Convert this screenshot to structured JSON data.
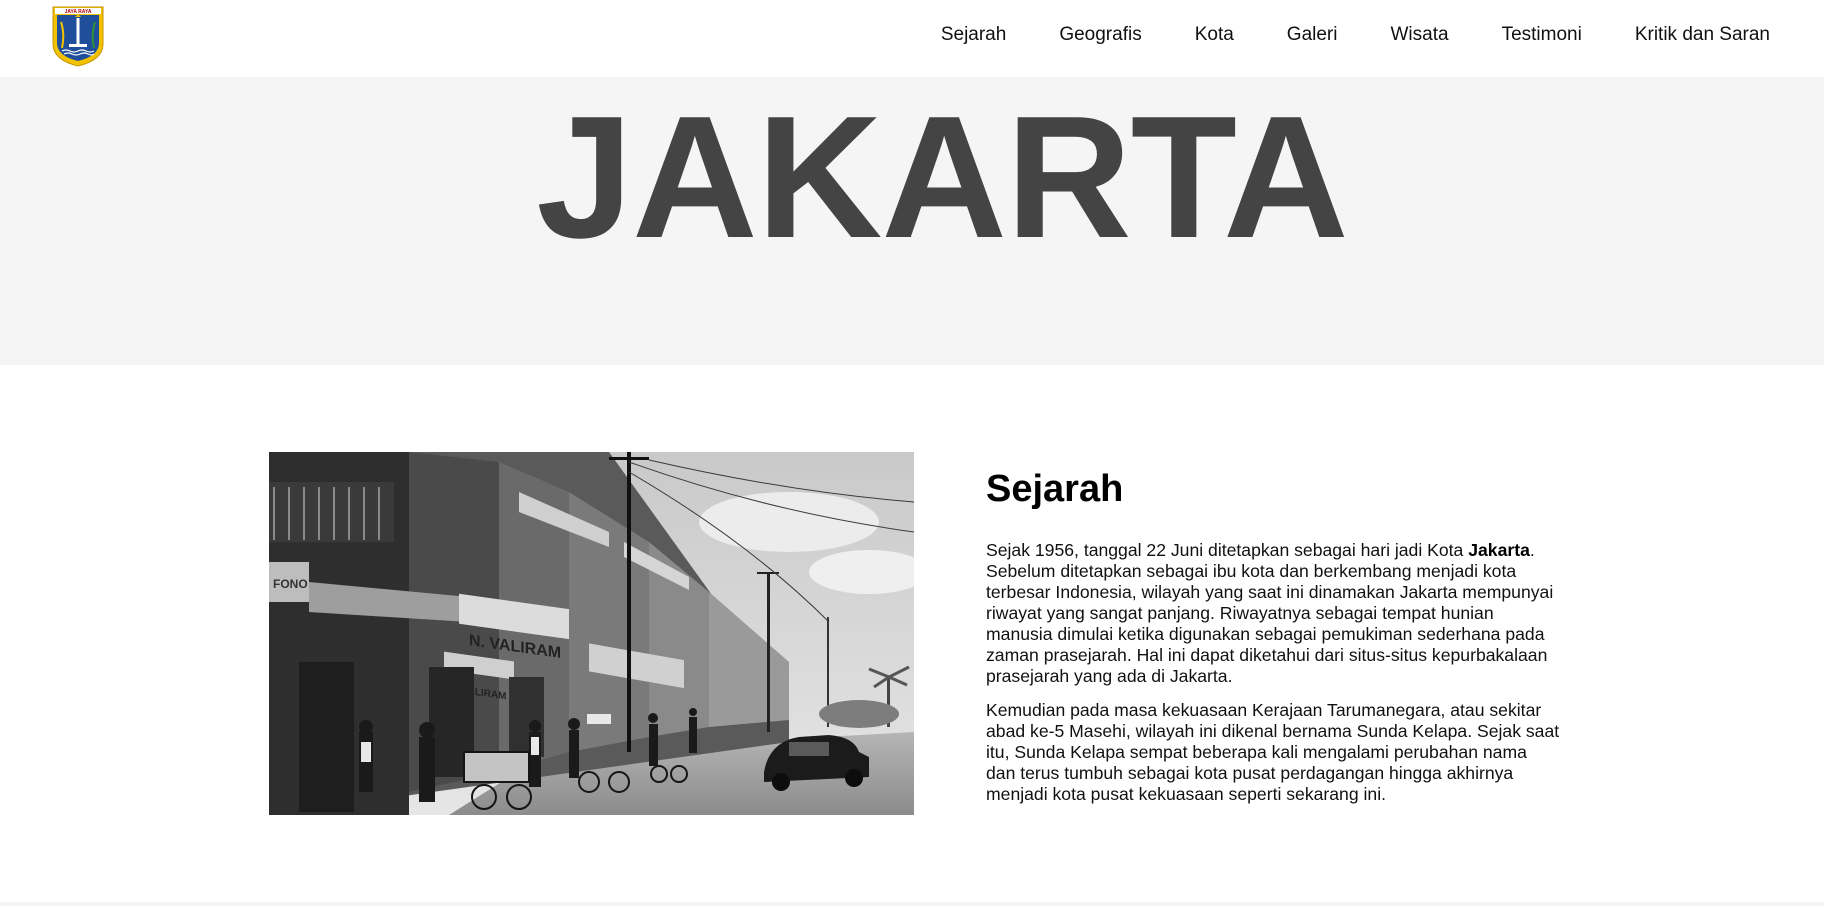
{
  "header": {
    "logo": {
      "icon": "jakarta-coat-of-arms-icon",
      "text": "JAYA RAYA"
    },
    "nav": [
      {
        "label": "Sejarah"
      },
      {
        "label": "Geografis"
      },
      {
        "label": "Kota"
      },
      {
        "label": "Galeri"
      },
      {
        "label": "Wisata"
      },
      {
        "label": "Testimoni"
      },
      {
        "label": "Kritik dan Saran"
      }
    ]
  },
  "hero": {
    "title": "JAKARTA"
  },
  "history": {
    "image_alt": "Foto hitam putih jalan pertokoan Jakarta tempo dulu",
    "shop_signs": [
      "N. VALIRAM",
      "TOKO",
      "FONO"
    ],
    "heading": "Sejarah",
    "p1_before": "Sejak 1956, tanggal 22 Juni ditetapkan sebagai hari jadi Kota ",
    "p1_bold": "Jakarta",
    "p1_after": ". Sebelum ditetapkan sebagai ibu kota dan berkembang menjadi kota terbesar Indonesia, wilayah yang saat ini dinamakan Jakarta mempunyai riwayat yang sangat panjang. Riwayatnya sebagai tempat hunian manusia dimulai ketika digunakan sebagai pemukiman sederhana pada zaman prasejarah. Hal ini dapat diketahui dari situs-situs kepurbakalaan prasejarah yang ada di Jakarta.",
    "p2": "Kemudian pada masa kekuasaan Kerajaan Tarumanegara, atau sekitar abad ke-5 Masehi, wilayah ini dikenal bernama Sunda Kelapa. Sejak saat itu, Sunda Kelapa sempat beberapa kali mengalami perubahan nama dan terus tumbuh sebagai kota pusat perdagangan hingga akhirnya menjadi kota pusat kekuasaan seperti sekarang ini."
  },
  "colors": {
    "hero_bg": "#f5f5f5",
    "hero_text": "#444444",
    "logo_yellow": "#f2c200",
    "logo_blue": "#1f4f9a"
  }
}
